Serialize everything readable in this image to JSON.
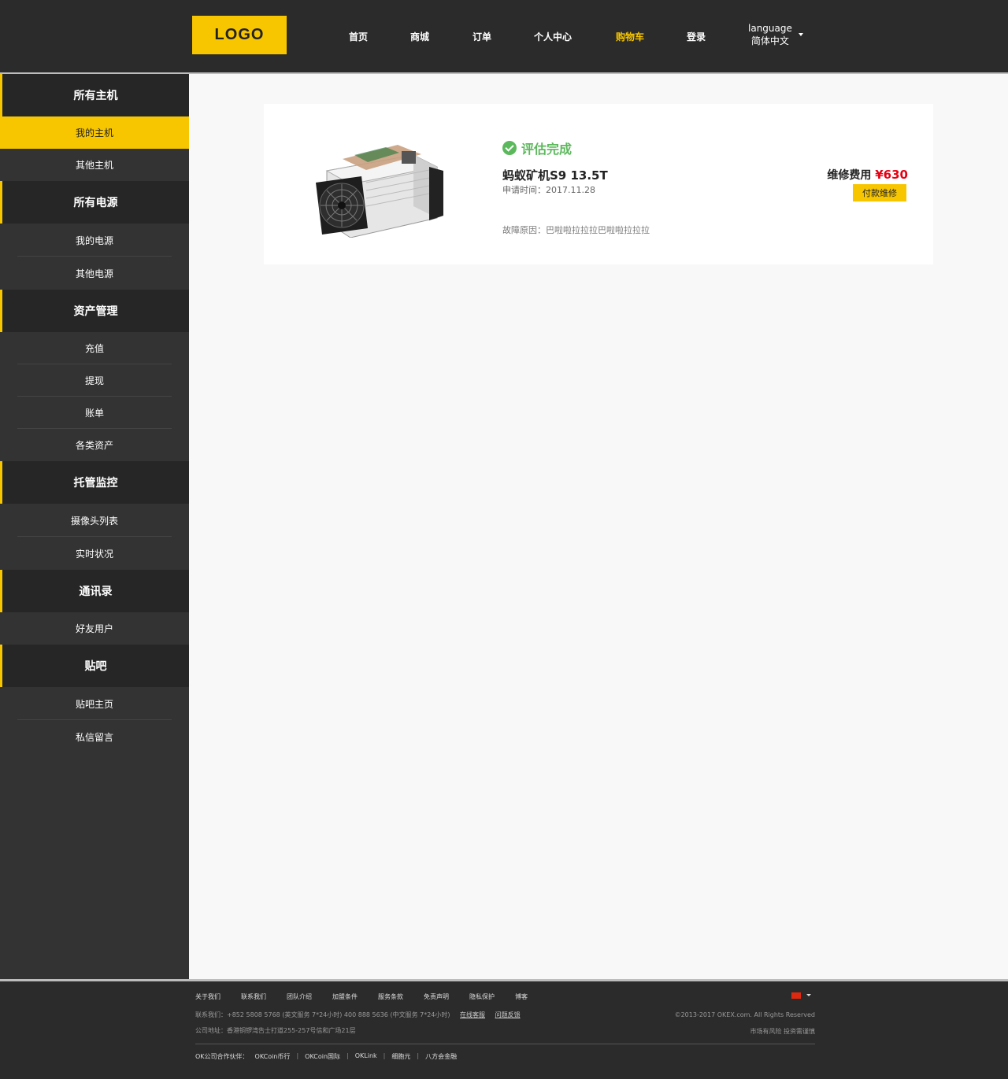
{
  "header": {
    "logo": "LOGO",
    "nav": [
      "首页",
      "商城",
      "订单",
      "个人中心",
      "购物车",
      "登录"
    ],
    "active_nav": "购物车",
    "language_label": "language",
    "language_value": "简体中文"
  },
  "sidebar": {
    "groups": [
      {
        "title": "所有主机",
        "items": [
          "我的主机",
          "其他主机"
        ]
      },
      {
        "title": "所有电源",
        "items": [
          "我的电源",
          "其他电源"
        ]
      },
      {
        "title": "资产管理",
        "items": [
          "充值",
          "提现",
          "账单",
          "各类资产"
        ]
      },
      {
        "title": "托管监控",
        "items": [
          "摄像头列表",
          "实时状况"
        ]
      },
      {
        "title": "通讯录",
        "items": [
          "好友用户"
        ]
      },
      {
        "title": "贴吧",
        "items": [
          "贴吧主页",
          "私信留言"
        ]
      }
    ],
    "active_item": "我的主机"
  },
  "order": {
    "status": "评估完成",
    "name": "蚂蚁矿机S9 13.5T",
    "date": "申请时间：2017.11.28",
    "reason": "故障原因：巴啦啦拉拉拉巴啦啦拉拉拉",
    "fee_label": "维修费用",
    "fee_amount": "¥630",
    "pay_label": "付款维修",
    "status_color": "#5cb85c",
    "accent": "#f7c600",
    "price_color": "#e60012"
  },
  "footer": {
    "links": [
      "关于我们",
      "联系我们",
      "团队介绍",
      "加盟条件",
      "服务条款",
      "免责声明",
      "隐私保护",
      "博客"
    ],
    "contact": "联系我们：+852 5808 5768 (英文服务 7*24小时)   400 888 5636 (中文服务 7*24小时)",
    "contact_links": [
      "在线客服",
      "问题反馈"
    ],
    "address": "公司地址：香港铜锣湾告士打道255-257号信和广场21层",
    "copyright": "©2013-2017 OKEX.com. All Rights Reserved",
    "risk": "市场有风险 投资需谨慎",
    "partners_label": "OK公司合作伙伴：",
    "partners": [
      "OKCoin币行",
      "OKCoin国际",
      "OKLink",
      "细胞元",
      "八方会金融"
    ]
  }
}
